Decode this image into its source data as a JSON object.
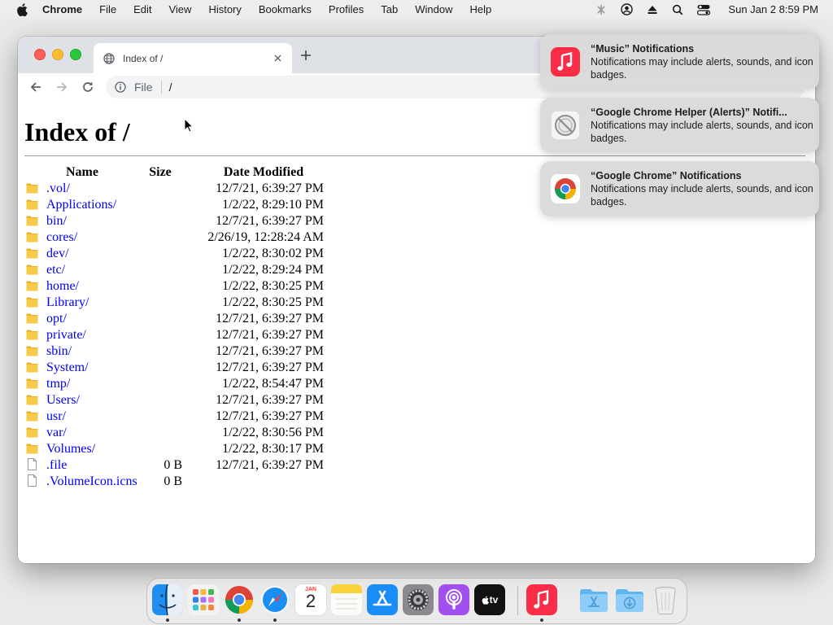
{
  "menubar": {
    "app_name": "Chrome",
    "items": [
      "File",
      "Edit",
      "View",
      "History",
      "Bookmarks",
      "Profiles",
      "Tab",
      "Window",
      "Help"
    ],
    "clock": "Sun Jan 2  8:59 PM"
  },
  "browser": {
    "tab_title": "Index of /",
    "omnibox_scheme": "File",
    "omnibox_url": "/"
  },
  "page": {
    "heading": "Index of /",
    "columns": {
      "name": "Name",
      "size": "Size",
      "date": "Date Modified"
    },
    "rows": [
      {
        "name": ".vol/",
        "size": "",
        "date": "12/7/21, 6:39:27 PM",
        "type": "folder"
      },
      {
        "name": "Applications/",
        "size": "",
        "date": "1/2/22, 8:29:10 PM",
        "type": "folder"
      },
      {
        "name": "bin/",
        "size": "",
        "date": "12/7/21, 6:39:27 PM",
        "type": "folder"
      },
      {
        "name": "cores/",
        "size": "",
        "date": "2/26/19, 12:28:24 AM",
        "type": "folder"
      },
      {
        "name": "dev/",
        "size": "",
        "date": "1/2/22, 8:30:02 PM",
        "type": "folder"
      },
      {
        "name": "etc/",
        "size": "",
        "date": "1/2/22, 8:29:24 PM",
        "type": "folder"
      },
      {
        "name": "home/",
        "size": "",
        "date": "1/2/22, 8:30:25 PM",
        "type": "folder"
      },
      {
        "name": "Library/",
        "size": "",
        "date": "1/2/22, 8:30:25 PM",
        "type": "folder"
      },
      {
        "name": "opt/",
        "size": "",
        "date": "12/7/21, 6:39:27 PM",
        "type": "folder"
      },
      {
        "name": "private/",
        "size": "",
        "date": "12/7/21, 6:39:27 PM",
        "type": "folder"
      },
      {
        "name": "sbin/",
        "size": "",
        "date": "12/7/21, 6:39:27 PM",
        "type": "folder"
      },
      {
        "name": "System/",
        "size": "",
        "date": "12/7/21, 6:39:27 PM",
        "type": "folder"
      },
      {
        "name": "tmp/",
        "size": "",
        "date": "1/2/22, 8:54:47 PM",
        "type": "folder"
      },
      {
        "name": "Users/",
        "size": "",
        "date": "12/7/21, 6:39:27 PM",
        "type": "folder"
      },
      {
        "name": "usr/",
        "size": "",
        "date": "12/7/21, 6:39:27 PM",
        "type": "folder"
      },
      {
        "name": "var/",
        "size": "",
        "date": "1/2/22, 8:30:56 PM",
        "type": "folder"
      },
      {
        "name": "Volumes/",
        "size": "",
        "date": "1/2/22, 8:30:17 PM",
        "type": "folder"
      },
      {
        "name": ".file",
        "size": "0 B",
        "date": "12/7/21, 6:39:27 PM",
        "type": "file"
      },
      {
        "name": ".VolumeIcon.icns",
        "size": "0 B",
        "date": "",
        "type": "file"
      }
    ]
  },
  "notifications": [
    {
      "title": "“Music” Notifications",
      "body": "Notifications may include alerts, sounds, and icon badges.",
      "icon": "music-app-icon"
    },
    {
      "title": "“Google Chrome Helper (Alerts)” Notifi...",
      "body": "Notifications may include alerts, sounds, and icon badges.",
      "icon": "chrome-helper-icon"
    },
    {
      "title": "“Google Chrome” Notifications",
      "body": "Notifications may include alerts, sounds, and icon badges.",
      "icon": "chrome-app-icon"
    }
  ],
  "dock": {
    "apps": [
      "finder",
      "launchpad",
      "chrome",
      "safari",
      "calendar",
      "notes",
      "app-store",
      "system-preferences",
      "podcasts",
      "apple-tv",
      "music",
      "applications-folder",
      "downloads-folder",
      "trash"
    ],
    "calendar_month": "JAN",
    "calendar_day": "2",
    "tv_label": "tv"
  },
  "colors": {
    "link": "#0000ee",
    "folder": "#f7c948",
    "music": "#fa2d48",
    "close": "#fe5f57",
    "minimize": "#febc2e",
    "maximize": "#28c840"
  }
}
